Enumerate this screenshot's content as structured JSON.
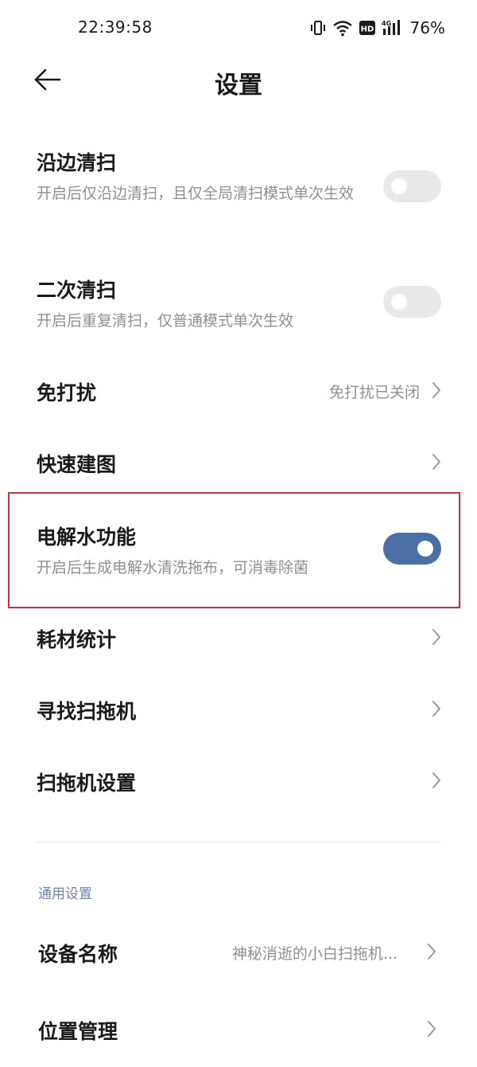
{
  "status_bar": {
    "time": "22:39:58",
    "battery": "76%",
    "icons": [
      "vibrate-icon",
      "wifi-icon",
      "hd-icon",
      "signal-4g-icon"
    ]
  },
  "header": {
    "title": "设置",
    "back_icon": "arrow-left-icon"
  },
  "settings": {
    "edge_clean": {
      "title": "沿边清扫",
      "desc": "开启后仅沿边清扫，且仅全局清扫模式单次生效",
      "enabled": false
    },
    "second_clean": {
      "title": "二次清扫",
      "desc": "开启后重复清扫，仅普通模式单次生效",
      "enabled": false
    },
    "do_not_disturb": {
      "title": "免打扰",
      "value": "免打扰已关闭"
    },
    "quick_map": {
      "title": "快速建图"
    },
    "electrolyzed_water": {
      "title": "电解水功能",
      "desc": "开启后生成电解水清洗拖布，可消毒除菌",
      "enabled": true
    },
    "consumables": {
      "title": "耗材统计"
    },
    "find_robot": {
      "title": "寻找扫拖机"
    },
    "robot_settings": {
      "title": "扫拖机设置"
    }
  },
  "general": {
    "section_label": "通用设置",
    "device_name": {
      "title": "设备名称",
      "value": "神秘消逝的小白扫拖机..."
    },
    "location": {
      "title": "位置管理"
    }
  },
  "colors": {
    "accent": "#4a6fa5",
    "highlight": "#c9303a",
    "toggle_off": "#e9e9e9",
    "secondary_text": "#8f8f8f",
    "section_label": "#6f82a8"
  }
}
